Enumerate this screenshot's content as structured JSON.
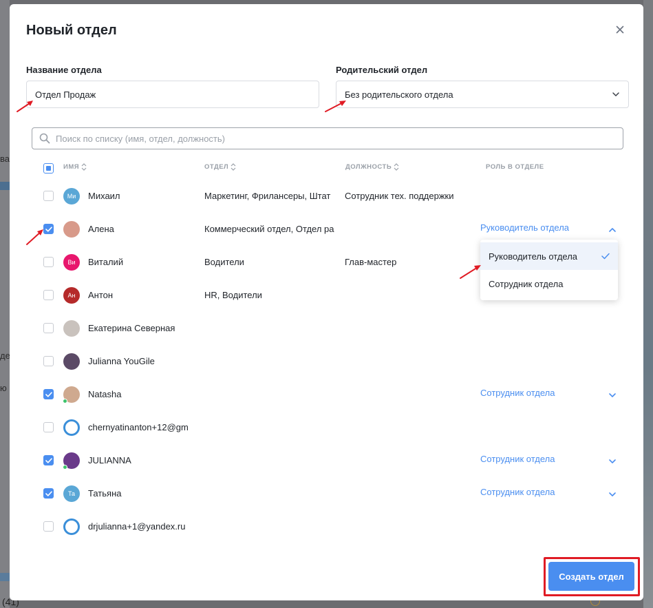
{
  "modal": {
    "title": "Новый отдел",
    "name_label": "Название отдела",
    "name_value": "Отдел Продаж",
    "parent_label": "Родительский отдел",
    "parent_value": "Без родительского отдела",
    "search_placeholder": "Поиск по списку (имя, отдел, должность)",
    "columns": [
      "ИМЯ",
      "ОТДЕЛ",
      "ДОЛЖНОСТЬ",
      "РОЛЬ В ОТДЕЛЕ"
    ],
    "rows": [
      {
        "name": "Михаил",
        "dept": "Маркетинг, Фрилансеры, Штат",
        "position": "Сотрудник тех. поддержки",
        "checked": false,
        "avatar": "Ми",
        "avatar_color": "#5aa7d6",
        "role": ""
      },
      {
        "name": "Алена",
        "dept": "Коммерческий отдел, Отдел ра",
        "position": "",
        "checked": true,
        "avatar": "",
        "avatar_color": "#d89a8a",
        "role": "Руководитель отдела"
      },
      {
        "name": "Виталий",
        "dept": "Водители",
        "position": "Глав-мастер",
        "checked": false,
        "avatar": "Ви",
        "avatar_color": "#e8176d",
        "role": ""
      },
      {
        "name": "Антон",
        "dept": "HR, Водители",
        "position": "",
        "checked": false,
        "avatar": "Ан",
        "avatar_color": "#b52a2a",
        "role": ""
      },
      {
        "name": "Екатерина Северная",
        "dept": "",
        "position": "",
        "checked": false,
        "avatar": "",
        "avatar_color": "#c9c2bd",
        "role": ""
      },
      {
        "name": "Julianna YouGile",
        "dept": "",
        "position": "",
        "checked": false,
        "avatar": "",
        "avatar_color": "#5b4a66",
        "role": ""
      },
      {
        "name": "Natasha",
        "dept": "",
        "position": "",
        "checked": true,
        "avatar": "",
        "avatar_color": "#cfa98f",
        "role": "Сотрудник отдела"
      },
      {
        "name": "chernyatinanton+12@gm",
        "dept": "",
        "position": "",
        "checked": false,
        "avatar": "",
        "avatar_color": "#3b8fd9",
        "role": ""
      },
      {
        "name": "JULIANNA",
        "dept": "",
        "position": "",
        "checked": true,
        "avatar": "",
        "avatar_color": "#6a3a8a",
        "role": "Сотрудник отдела"
      },
      {
        "name": "Татьяна",
        "dept": "",
        "position": "",
        "checked": true,
        "avatar": "Та",
        "avatar_color": "#5aa7d6",
        "role": "Сотрудник отдела"
      },
      {
        "name": "drjulianna+1@yandex.ru",
        "dept": "",
        "position": "",
        "checked": false,
        "avatar": "",
        "avatar_color": "#3b8fd9",
        "role": ""
      }
    ],
    "dropdown": {
      "options": [
        "Руководитель отдела",
        "Сотрудник отдела"
      ],
      "selected": "Руководитель отдела"
    },
    "create_label": "Создать отдел"
  },
  "backdrop": {
    "left_fragments": [
      "ва",
      "де",
      "ю",
      "ю"
    ],
    "bottom_left": "(41)"
  },
  "colors": {
    "accent": "#4a8ef0",
    "annotation_red": "#e01b24"
  }
}
